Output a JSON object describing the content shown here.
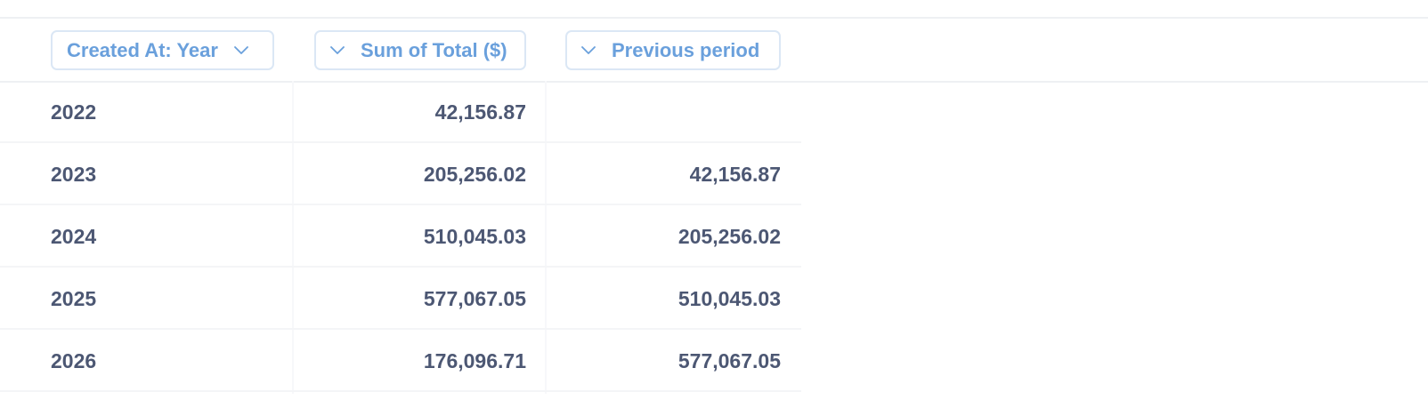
{
  "table": {
    "columns": [
      {
        "label": "Created At: Year",
        "icon": "chevron-down-icon"
      },
      {
        "label": "Sum of Total ($)",
        "icon": "chevron-down-icon"
      },
      {
        "label": "Previous period",
        "icon": "chevron-down-icon"
      }
    ],
    "rows": [
      {
        "year": "2022",
        "sum": "42,156.87",
        "previous": ""
      },
      {
        "year": "2023",
        "sum": "205,256.02",
        "previous": "42,156.87"
      },
      {
        "year": "2024",
        "sum": "510,045.03",
        "previous": "205,256.02"
      },
      {
        "year": "2025",
        "sum": "577,067.05",
        "previous": "510,045.03"
      },
      {
        "year": "2026",
        "sum": "176,096.71",
        "previous": "577,067.05"
      }
    ]
  },
  "colors": {
    "header_text": "#6aa0dc",
    "header_border": "#dbe7f5",
    "cell_text": "#4c5773",
    "divider": "#eef0f3"
  }
}
